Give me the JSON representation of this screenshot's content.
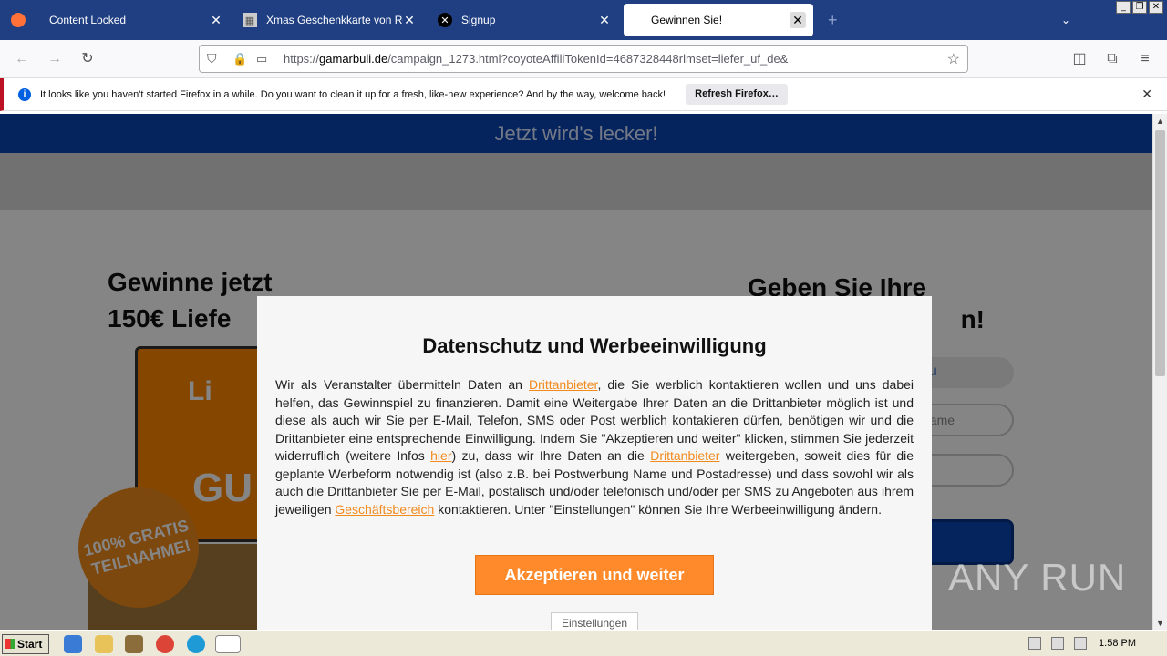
{
  "browser": {
    "tabs": [
      {
        "title": "Content Locked",
        "icon": "firefox-icon"
      },
      {
        "title": "Xmas Geschenkkarte von Rossm",
        "icon": "gift-icon"
      },
      {
        "title": "Signup",
        "icon": "x-logo-icon"
      },
      {
        "title": "Gewinnen Sie!",
        "icon": "page-icon"
      }
    ],
    "new_tab": "+",
    "url_domain_prefix": "https://",
    "url_domain": "gamarbuli.de",
    "url_path": "/campaign_1273.html?coyoteAffiliTokenId=4687328448rlmset=liefer_uf_de&"
  },
  "notification": {
    "message": "It looks like you haven't started Firefox in a while. Do you want to clean it up for a fresh, like-new experience? And by the way, welcome back!",
    "button": "Refresh Firefox…"
  },
  "page": {
    "banner": "Jetzt wird's lecker!",
    "headline_left_1": "Gewinne jetzt",
    "headline_left_2": "150€ Liefe",
    "headline_right_1": "Geben Sie Ihre",
    "headline_right_2": "n!",
    "promo_brand": "Li",
    "promo_big": "GU",
    "stamp_text": "100% GRATIS TEILNAHME!",
    "field1": "u",
    "field2": "name"
  },
  "modal": {
    "title": "Datenschutz und Werbeeinwilligung",
    "p1": "Wir als Veranstalter übermitteln Daten an ",
    "link1": "Drittanbieter",
    "p2": ", die Sie werblich kontaktieren wollen und uns dabei helfen, das Gewinnspiel zu finanzieren. Damit eine Weitergabe Ihrer Daten an die Drittanbieter möglich ist und diese als auch wir Sie per E-Mail, Telefon, SMS oder Post werblich kontakieren dürfen, benötigen wir und die Drittanbieter eine entsprechende Einwilligung. Indem Sie \"Akzeptieren und weiter\" klicken, stimmen Sie jederzeit widerruflich (weitere Infos ",
    "link2": "hier",
    "p3": ") zu, dass wir Ihre Daten an die ",
    "link3": "Drittanbieter",
    "p4": " weitergeben, soweit dies für die geplante Werbeform notwendig ist (also z.B. bei Postwerbung Name und Postadresse) und dass sowohl wir als auch die Drittanbieter Sie per E-Mail, postalisch und/oder telefonisch und/oder per SMS zu Angeboten aus ihrem jeweiligen ",
    "link4": "Geschäftsbereich",
    "p5": " kontaktieren. Unter \"Einstellungen\" können Sie Ihre Werbeeinwilligung ändern.",
    "accept": "Akzeptieren und weiter",
    "settings": "Einstellungen"
  },
  "watermark": "ANY RUN",
  "taskbar": {
    "start": "Start",
    "clock": "1:58 PM"
  }
}
